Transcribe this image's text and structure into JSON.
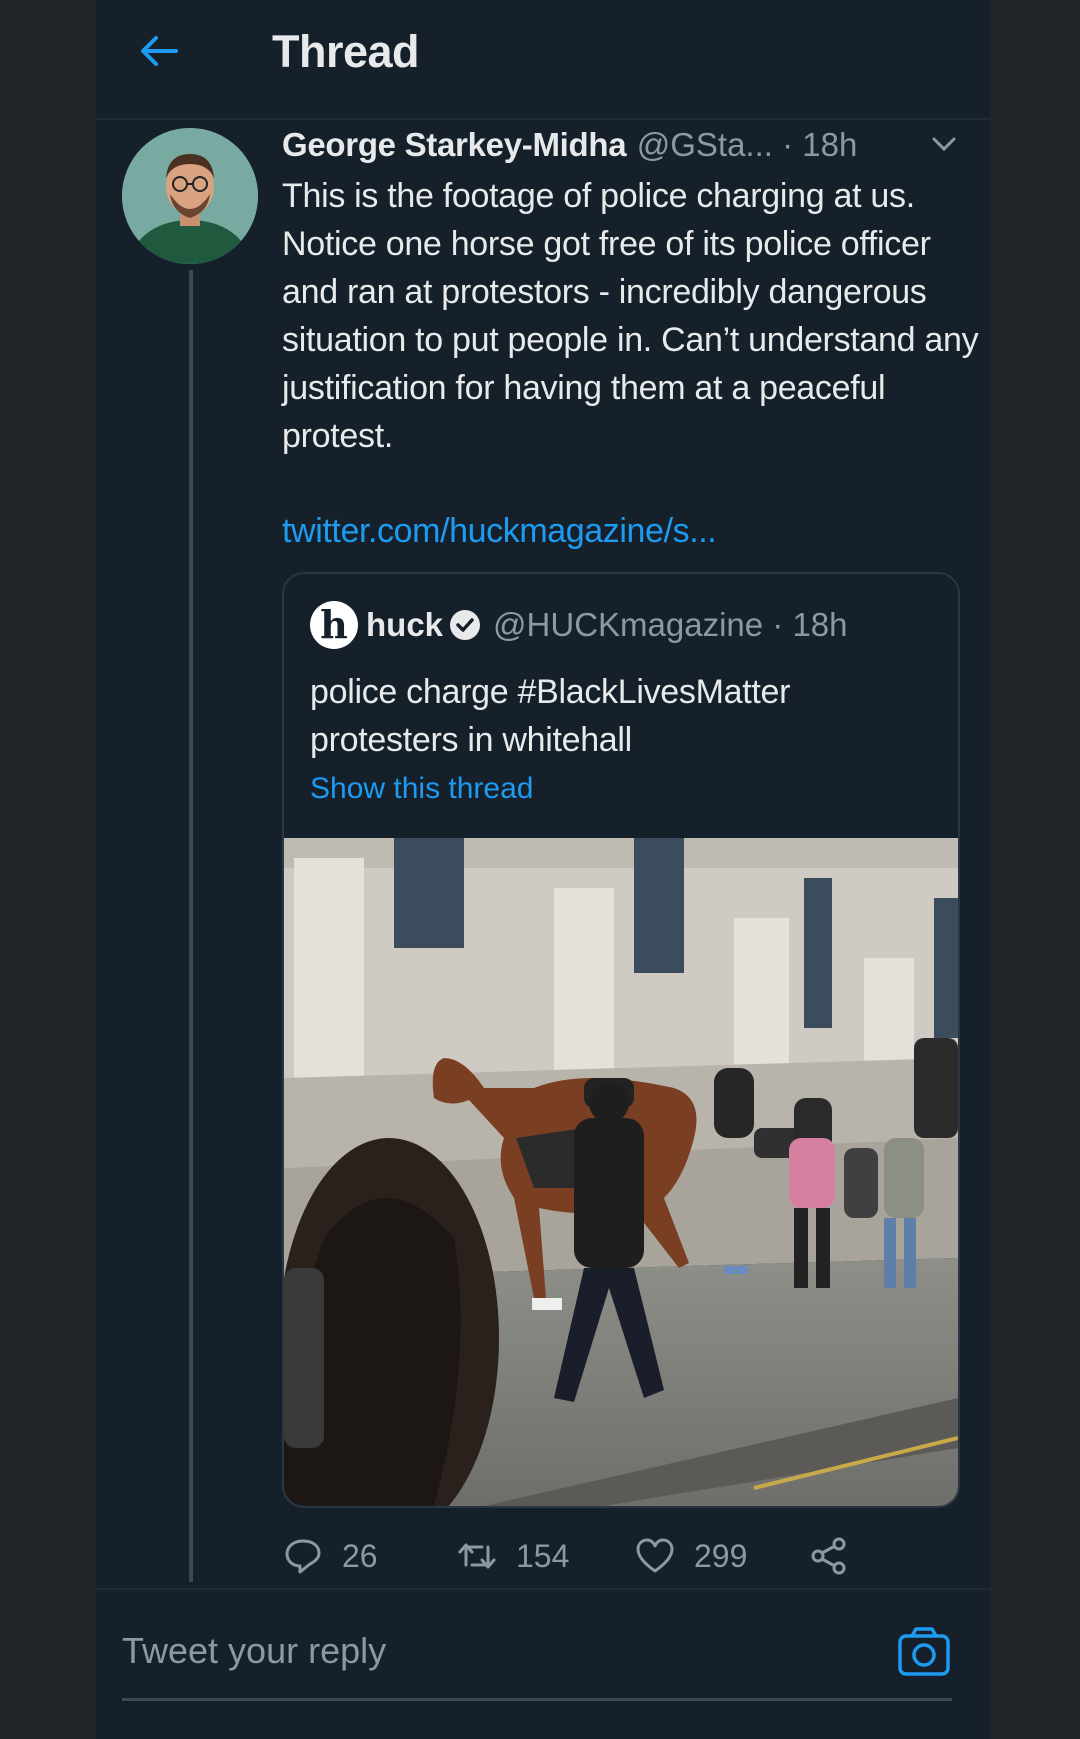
{
  "header": {
    "title": "Thread",
    "back_icon": "arrow-left-icon",
    "accent_color": "#1d9bf0"
  },
  "tweet": {
    "author_name": "George Starkey-Midha",
    "author_meta": "@GSta... · 18h",
    "text": "This is the footage of police charging at us. Notice one horse got free of its police officer and ran at protestors - incredibly dangerous situation to put people in. Can’t understand any justification for having them at a peaceful protest.",
    "link": "twitter.com/huckmagazine/s...",
    "quoted": {
      "logo": "h",
      "name": "huck",
      "meta": "@HUCKmagazine · 18h",
      "text": "police charge #BlackLivesMatter protesters in whitehall",
      "show_thread": "Show this thread"
    },
    "actions": {
      "replies": "26",
      "retweets": "154",
      "likes": "299"
    }
  },
  "reply": {
    "placeholder": "Tweet your reply"
  }
}
